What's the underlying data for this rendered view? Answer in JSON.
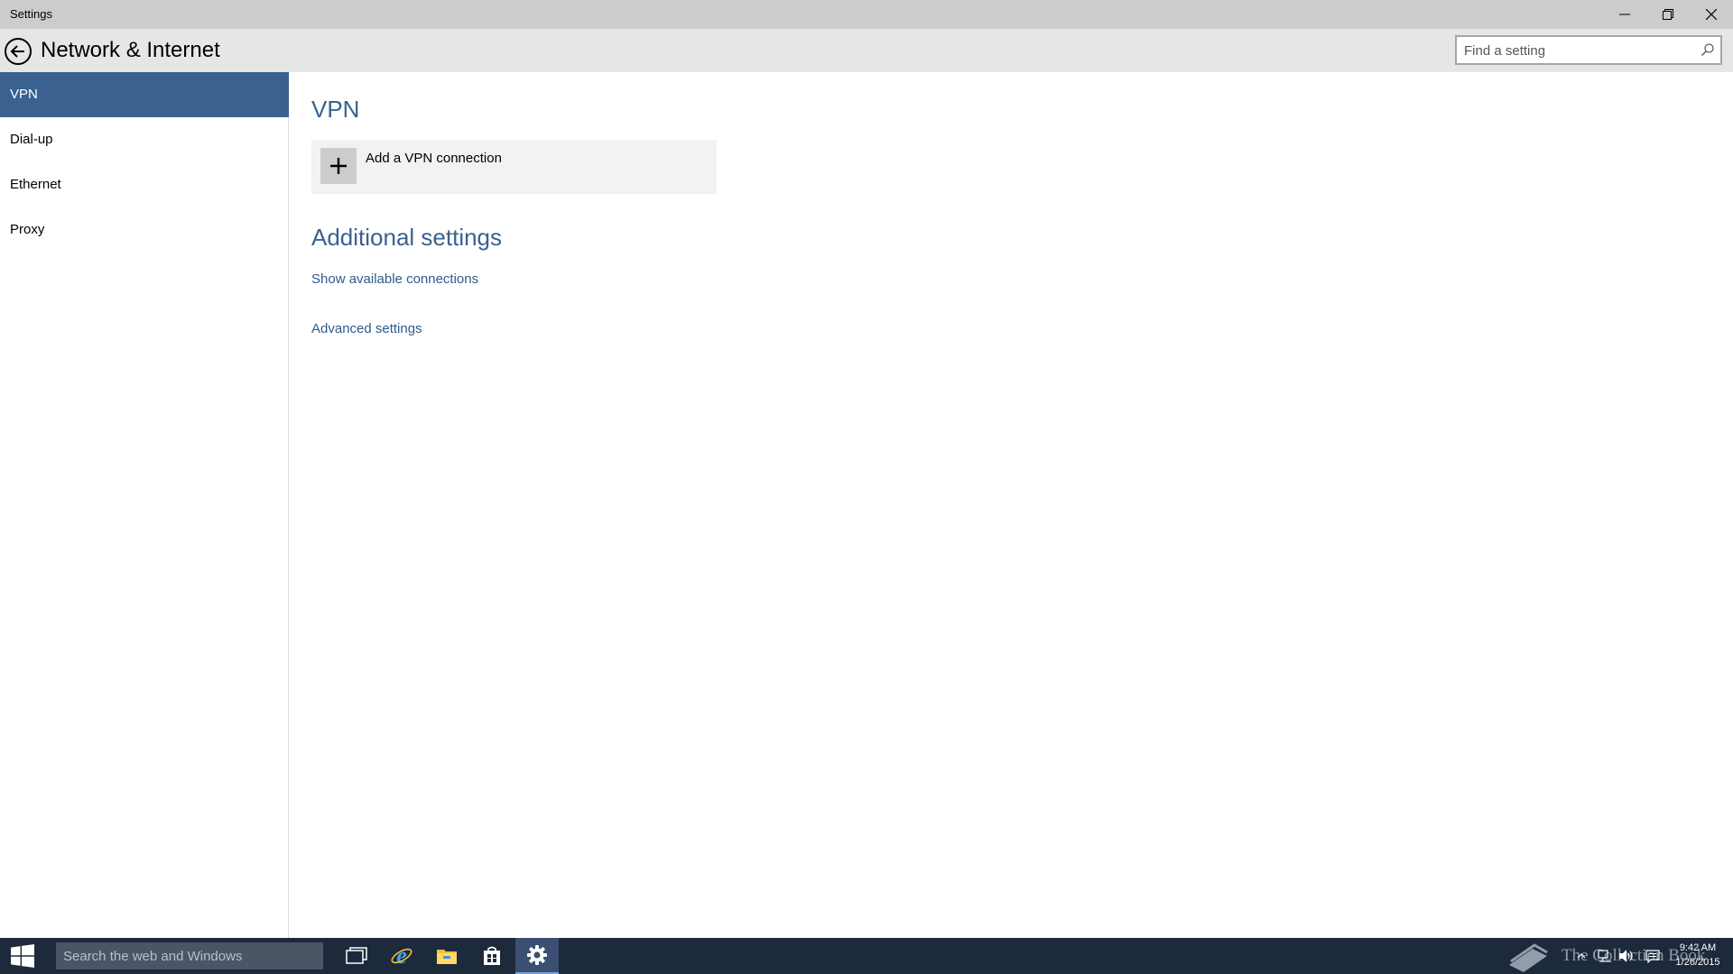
{
  "window": {
    "title": "Settings"
  },
  "header": {
    "title": "Network & Internet",
    "search_placeholder": "Find a setting"
  },
  "sidebar": {
    "items": [
      {
        "label": "VPN",
        "active": true
      },
      {
        "label": "Dial-up",
        "active": false
      },
      {
        "label": "Ethernet",
        "active": false
      },
      {
        "label": "Proxy",
        "active": false
      }
    ]
  },
  "main": {
    "section_title": "VPN",
    "add_vpn_label": "Add a VPN connection",
    "additional_title": "Additional settings",
    "links": [
      "Show available connections",
      "Advanced settings"
    ]
  },
  "taskbar": {
    "search_placeholder": "Search the web and Windows",
    "apps": [
      "task-view-icon",
      "internet-explorer-icon",
      "file-explorer-icon",
      "store-icon",
      "settings-icon"
    ],
    "active_app": "settings-icon",
    "watermark": "The Collection Book",
    "clock_time": "9:42 AM",
    "clock_date": "1/26/2015"
  },
  "colors": {
    "accent": "#3a6190",
    "titlebar": "#cccccc",
    "header": "#e6e6e6",
    "taskbar": "#1d2a3c",
    "link": "#2e5c8a"
  }
}
